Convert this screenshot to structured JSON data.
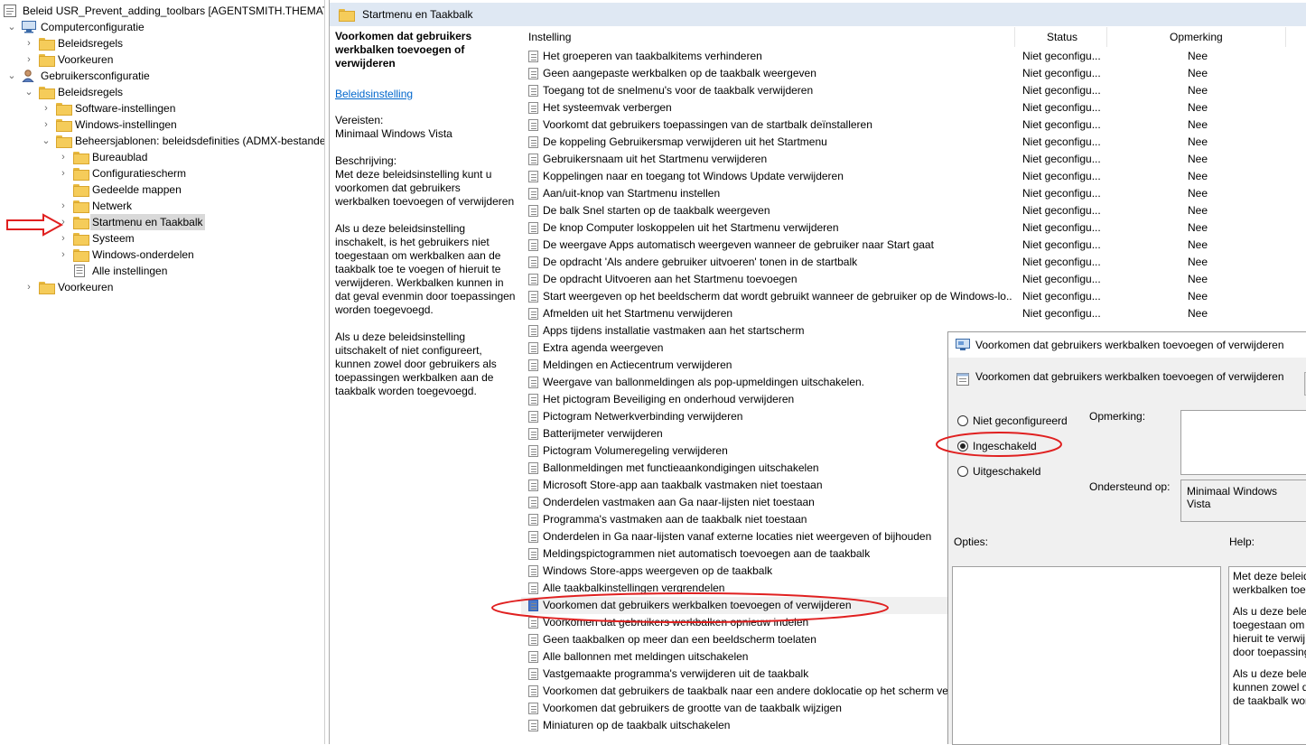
{
  "tree": {
    "items": [
      {
        "label": "Beleid USR_Prevent_adding_toolbars [AGENTSMITH.THEMATRI",
        "level": 0,
        "exp": "",
        "icon": "policy"
      },
      {
        "label": "Computerconfiguratie",
        "level": 0,
        "exp": "open",
        "icon": "computer"
      },
      {
        "label": "Beleidsregels",
        "level": 1,
        "exp": "closed",
        "icon": "folder"
      },
      {
        "label": "Voorkeuren",
        "level": 1,
        "exp": "closed",
        "icon": "folder"
      },
      {
        "label": "Gebruikersconfiguratie",
        "level": 0,
        "exp": "open",
        "icon": "user"
      },
      {
        "label": "Beleidsregels",
        "level": 1,
        "exp": "open",
        "icon": "folder"
      },
      {
        "label": "Software-instellingen",
        "level": 2,
        "exp": "closed",
        "icon": "folder"
      },
      {
        "label": "Windows-instellingen",
        "level": 2,
        "exp": "closed",
        "icon": "folder"
      },
      {
        "label": "Beheersjablonen: beleidsdefinities (ADMX-bestanden)",
        "level": 2,
        "exp": "open",
        "icon": "folder"
      },
      {
        "label": "Bureaublad",
        "level": 3,
        "exp": "closed",
        "icon": "folder"
      },
      {
        "label": "Configuratiescherm",
        "level": 3,
        "exp": "closed",
        "icon": "folder"
      },
      {
        "label": "Gedeelde mappen",
        "level": 3,
        "exp": "",
        "icon": "folder"
      },
      {
        "label": "Netwerk",
        "level": 3,
        "exp": "closed",
        "icon": "folder"
      },
      {
        "label": "Startmenu en Taakbalk",
        "level": 3,
        "exp": "closed",
        "icon": "folder",
        "selected": true
      },
      {
        "label": "Systeem",
        "level": 3,
        "exp": "closed",
        "icon": "folder"
      },
      {
        "label": "Windows-onderdelen",
        "level": 3,
        "exp": "closed",
        "icon": "folder"
      },
      {
        "label": "Alle instellingen",
        "level": 3,
        "exp": "",
        "icon": "settings"
      },
      {
        "label": "Voorkeuren",
        "level": 1,
        "exp": "closed",
        "icon": "folder"
      }
    ]
  },
  "header": {
    "title": "Startmenu en Taakbalk"
  },
  "description": {
    "heading": "Voorkomen dat gebruikers werkbalken toevoegen of verwijderen",
    "link": "Beleidsinstelling",
    "requirements_label": "Vereisten:",
    "requirements_value": "Minimaal Windows Vista",
    "description_label": "Beschrijving:",
    "p1": "Met deze beleidsinstelling kunt u voorkomen dat gebruikers werkbalken toevoegen of verwijderen",
    "p2": "Als u deze beleidsinstelling inschakelt, is het gebruikers niet toegestaan om werkbalken aan de taakbalk toe te voegen of hieruit te verwijderen. Werkbalken kunnen in dat geval evenmin door toepassingen worden toegevoegd.",
    "p3": "Als u deze beleidsinstelling uitschakelt of niet configureert, kunnen zowel door gebruikers als toepassingen werkbalken aan de taakbalk worden toegevoegd."
  },
  "columns": {
    "setting": "Instelling",
    "status": "Status",
    "comment": "Opmerking"
  },
  "settings": [
    {
      "name": "Het groeperen van taakbalkitems verhinderen",
      "status": "Niet geconfigu...",
      "comment": "Nee"
    },
    {
      "name": "Geen aangepaste werkbalken op de taakbalk weergeven",
      "status": "Niet geconfigu...",
      "comment": "Nee"
    },
    {
      "name": "Toegang tot de snelmenu's voor de taakbalk verwijderen",
      "status": "Niet geconfigu...",
      "comment": "Nee"
    },
    {
      "name": "Het systeemvak verbergen",
      "status": "Niet geconfigu...",
      "comment": "Nee"
    },
    {
      "name": "Voorkomt dat gebruikers toepassingen van de startbalk deïnstalleren",
      "status": "Niet geconfigu...",
      "comment": "Nee"
    },
    {
      "name": "De koppeling Gebruikersmap verwijderen uit het Startmenu",
      "status": "Niet geconfigu...",
      "comment": "Nee"
    },
    {
      "name": "Gebruikersnaam uit het Startmenu verwijderen",
      "status": "Niet geconfigu...",
      "comment": "Nee"
    },
    {
      "name": "Koppelingen naar en toegang tot Windows Update verwijderen",
      "status": "Niet geconfigu...",
      "comment": "Nee"
    },
    {
      "name": "Aan/uit-knop van Startmenu instellen",
      "status": "Niet geconfigu...",
      "comment": "Nee"
    },
    {
      "name": "De balk Snel starten op de taakbalk weergeven",
      "status": "Niet geconfigu...",
      "comment": "Nee"
    },
    {
      "name": "De knop Computer loskoppelen uit het Startmenu verwijderen",
      "status": "Niet geconfigu...",
      "comment": "Nee"
    },
    {
      "name": "De weergave Apps automatisch weergeven wanneer de gebruiker naar Start gaat",
      "status": "Niet geconfigu...",
      "comment": "Nee"
    },
    {
      "name": "De opdracht 'Als andere gebruiker uitvoeren' tonen in de startbalk",
      "status": "Niet geconfigu...",
      "comment": "Nee"
    },
    {
      "name": "De opdracht Uitvoeren aan het Startmenu toevoegen",
      "status": "Niet geconfigu...",
      "comment": "Nee"
    },
    {
      "name": "Start weergeven op het beeldscherm dat wordt gebruikt wanneer de gebruiker op de Windows-lo...",
      "status": "Niet geconfigu...",
      "comment": "Nee"
    },
    {
      "name": "Afmelden uit het Startmenu verwijderen",
      "status": "Niet geconfigu...",
      "comment": "Nee"
    },
    {
      "name": "Apps tijdens installatie vastmaken aan het startscherm",
      "status": "",
      "comment": ""
    },
    {
      "name": "Extra agenda weergeven",
      "status": "",
      "comment": ""
    },
    {
      "name": "Meldingen en Actiecentrum verwijderen",
      "status": "",
      "comment": ""
    },
    {
      "name": "Weergave van ballonmeldingen als pop-upmeldingen uitschakelen.",
      "status": "",
      "comment": ""
    },
    {
      "name": "Het pictogram Beveiliging en onderhoud verwijderen",
      "status": "",
      "comment": ""
    },
    {
      "name": "Pictogram Netwerkverbinding verwijderen",
      "status": "",
      "comment": ""
    },
    {
      "name": "Batterijmeter verwijderen",
      "status": "",
      "comment": ""
    },
    {
      "name": "Pictogram Volumeregeling verwijderen",
      "status": "",
      "comment": ""
    },
    {
      "name": "Ballonmeldingen met functieaankondigingen uitschakelen",
      "status": "",
      "comment": ""
    },
    {
      "name": "Microsoft Store-app aan taakbalk vastmaken niet toestaan",
      "status": "",
      "comment": ""
    },
    {
      "name": "Onderdelen vastmaken aan Ga naar-lijsten niet toestaan",
      "status": "",
      "comment": ""
    },
    {
      "name": "Programma's vastmaken aan de taakbalk niet toestaan",
      "status": "",
      "comment": ""
    },
    {
      "name": "Onderdelen in Ga naar-lijsten vanaf externe locaties niet weergeven of bijhouden",
      "status": "",
      "comment": ""
    },
    {
      "name": "Meldingspictogrammen niet automatisch toevoegen aan de taakbalk",
      "status": "",
      "comment": ""
    },
    {
      "name": "Windows Store-apps weergeven op de taakbalk",
      "status": "",
      "comment": ""
    },
    {
      "name": "Alle taakbalkinstellingen vergrendelen",
      "status": "",
      "comment": ""
    },
    {
      "name": "Voorkomen dat gebruikers werkbalken toevoegen of verwijderen",
      "status": "",
      "comment": "",
      "highlighted": true
    },
    {
      "name": "Voorkomen dat gebruikers werkbalken opnieuw indelen",
      "status": "",
      "comment": ""
    },
    {
      "name": "Geen taakbalken op meer dan een beeldscherm toelaten",
      "status": "",
      "comment": ""
    },
    {
      "name": "Alle ballonnen met meldingen uitschakelen",
      "status": "",
      "comment": ""
    },
    {
      "name": "Vastgemaakte programma's verwijderen uit de taakbalk",
      "status": "",
      "comment": ""
    },
    {
      "name": "Voorkomen dat gebruikers de taakbalk naar een andere doklocatie op het scherm verplaatsen",
      "status": "",
      "comment": ""
    },
    {
      "name": "Voorkomen dat gebruikers de grootte van de taakbalk wijzigen",
      "status": "",
      "comment": ""
    },
    {
      "name": "Miniaturen op de taakbalk uitschakelen",
      "status": "",
      "comment": ""
    }
  ],
  "dialog": {
    "title": "Voorkomen dat gebruikers werkbalken toevoegen of verwijderen",
    "subtitle": "Voorkomen dat gebruikers werkbalken toevoegen of verwijderen",
    "radio_not_configured": "Niet geconfigureerd",
    "radio_enabled": "Ingeschakeld",
    "radio_disabled": "Uitgeschakeld",
    "selected": "enabled",
    "comment_label": "Opmerking:",
    "supported_label": "Ondersteund op:",
    "supported_value": "Minimaal Windows Vista",
    "options_label": "Opties:",
    "help_label": "Help:",
    "help_p1_l1": "Met deze beleid",
    "help_p1_l2": "werkbalken toev",
    "help_p2_l1": "Als u deze beleid",
    "help_p2_l2": "toegestaan om w",
    "help_p2_l3": "hieruit te verwij",
    "help_p2_l4": "door toepassing",
    "help_p3_l1": "Als u deze beleid",
    "help_p3_l2": "kunnen zowel do",
    "help_p3_l3": "de taakbalk wor"
  },
  "colors": {
    "annotation": "#e02020",
    "header_bg": "#dfe8f3",
    "selection": "#d9d9d9"
  }
}
